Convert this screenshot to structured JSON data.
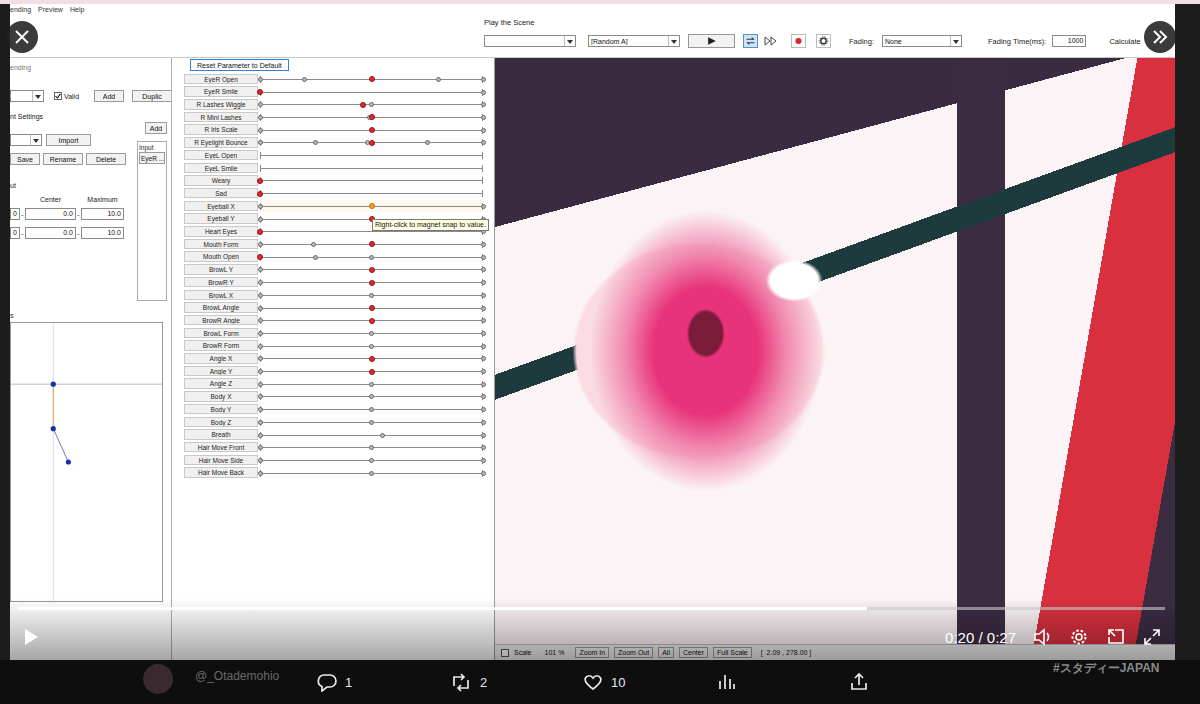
{
  "menu": [
    "ending",
    "Preview",
    "Help"
  ],
  "toolbar": {
    "label": "Play the Scene",
    "scene": "",
    "preset": "[Random A]",
    "loop_on": true,
    "fading_label": "Fading:",
    "fading": "None",
    "fading_time_label": "Fading Time(ms):",
    "fading_time": "1000",
    "calculate": "Calculate"
  },
  "left_panel": {
    "group_title": "ending",
    "valid": {
      "label": "Valid",
      "checked": true
    },
    "top_buttons": [
      "Add",
      "Duplic"
    ],
    "settings_title": "nt Settings",
    "add_button": "Add",
    "import_button": "Import",
    "file_buttons": [
      "Save",
      "Rename",
      "Delete"
    ],
    "input_box": {
      "title": "Input",
      "item": "EyeR ..."
    },
    "range_title": "ut",
    "range_headers": [
      "Center",
      "Maximum"
    ],
    "range_rows": [
      {
        "min": "0",
        "sep": "-",
        "center": "0.0",
        "sep2": "-",
        "max": "10.0"
      },
      {
        "min": "0",
        "sep": "-",
        "center": "0.0",
        "sep2": "-",
        "max": "10.0"
      }
    ],
    "graph_title": "s",
    "graph": {
      "points": [
        [
          0.28,
          0.22
        ],
        [
          0.28,
          0.38
        ],
        [
          0.38,
          0.5
        ]
      ]
    }
  },
  "parameter_panel": {
    "reset_button": "Reset Parameter to Default",
    "parameters": [
      {
        "name": "EyeR Open",
        "keys": [
          0,
          0.2,
          0.8,
          1
        ],
        "level": 0.5,
        "hovered": false
      },
      {
        "name": "EyeR Smile",
        "keys": [
          1
        ],
        "level": 0,
        "hovered": false
      },
      {
        "name": "R Lashes Wiggle",
        "keys": [
          0,
          0.5,
          1
        ],
        "level": 0.46,
        "hovered": false
      },
      {
        "name": "R Mini Lashes",
        "keys": [
          0,
          0.49,
          1
        ],
        "level": 0.5,
        "hovered": false
      },
      {
        "name": "R Iris Scale",
        "keys": [
          0,
          1
        ],
        "level": 0.5,
        "hovered": false
      },
      {
        "name": "R Eyelight Bounce",
        "keys": [
          0,
          0.25,
          0.48,
          0.75,
          1
        ],
        "level": 0.5,
        "hovered": false
      },
      {
        "name": "EyeL Open",
        "keys": [],
        "level": null,
        "hovered": false
      },
      {
        "name": "EyeL Smile",
        "keys": [],
        "level": null,
        "hovered": false
      },
      {
        "name": "Weary",
        "keys": [],
        "level": 0,
        "hovered": false
      },
      {
        "name": "Sad",
        "keys": [],
        "level": 0,
        "hovered": false
      },
      {
        "name": "Eyeball X",
        "keys": [
          0,
          1
        ],
        "level": 0.5,
        "hovered": true
      },
      {
        "name": "Eyeball Y",
        "keys": [
          0,
          1
        ],
        "level": 0.5,
        "hovered": false
      },
      {
        "name": "Heart Eyes",
        "keys": [
          1
        ],
        "level": 0,
        "hovered": false
      },
      {
        "name": "Mouth Form",
        "keys": [
          0,
          0.24,
          1
        ],
        "level": 0.5,
        "hovered": false
      },
      {
        "name": "Mouth Open",
        "keys": [
          0.25,
          0.5,
          1
        ],
        "level": 0,
        "hovered": false
      },
      {
        "name": "BrowL Y",
        "keys": [
          0,
          1
        ],
        "level": 0.5,
        "hovered": false
      },
      {
        "name": "BrowR Y",
        "keys": [
          0,
          1
        ],
        "level": 0.5,
        "hovered": false
      },
      {
        "name": "BrowL X",
        "keys": [
          0,
          0.5,
          1
        ],
        "level": null,
        "hovered": false
      },
      {
        "name": "BrowL Angle",
        "keys": [
          0,
          1
        ],
        "level": 0.5,
        "hovered": false
      },
      {
        "name": "BrowR Angle",
        "keys": [
          0,
          1
        ],
        "level": 0.5,
        "hovered": false
      },
      {
        "name": "BrowL Form",
        "keys": [
          0,
          0.5,
          1
        ],
        "level": null,
        "hovered": false
      },
      {
        "name": "BrowR Form",
        "keys": [
          0,
          0.5,
          1
        ],
        "level": null,
        "hovered": false
      },
      {
        "name": "Angle X",
        "keys": [
          0,
          1
        ],
        "level": 0.5,
        "hovered": false
      },
      {
        "name": "Angle Y",
        "keys": [
          0,
          1
        ],
        "level": 0.5,
        "hovered": false
      },
      {
        "name": "Angle Z",
        "keys": [
          0,
          0.5,
          1
        ],
        "level": null,
        "hovered": false
      },
      {
        "name": "Body X",
        "keys": [
          0,
          0.5,
          1
        ],
        "level": null,
        "hovered": false
      },
      {
        "name": "Body Y",
        "keys": [
          0,
          0.5,
          1
        ],
        "level": null,
        "hovered": false
      },
      {
        "name": "Body Z",
        "keys": [
          0,
          0.5,
          1
        ],
        "level": null,
        "hovered": false
      },
      {
        "name": "Breath",
        "keys": [
          0,
          0.55,
          1
        ],
        "level": null,
        "hovered": false
      },
      {
        "name": "Hair Move Front",
        "keys": [
          0,
          0.5,
          1
        ],
        "level": null,
        "hovered": false
      },
      {
        "name": "Hair Move Side",
        "keys": [
          0,
          0.5,
          1
        ],
        "level": null,
        "hovered": false
      },
      {
        "name": "Hair Move Back",
        "keys": [
          0,
          0.5,
          1
        ],
        "level": null,
        "hovered": false
      }
    ]
  },
  "tooltip": "Right-click to magnet snap to value.",
  "view_bar": {
    "scale": {
      "label": "Scale",
      "checked": false
    },
    "zoom": "101 %",
    "buttons": [
      "Zoom In",
      "Zoom Out",
      "All",
      "Center",
      "Full Scale"
    ],
    "coords": "[  2.09 , 278.00 ]"
  },
  "player": {
    "playing": false,
    "progress": 0.74,
    "time": "0:20 / 0:27"
  },
  "post": {
    "author_handle": "@_Otademohio",
    "reply_count": "1",
    "repost_count": "2",
    "like_count": "10",
    "hashtag": "#スタディーJAPAN"
  }
}
